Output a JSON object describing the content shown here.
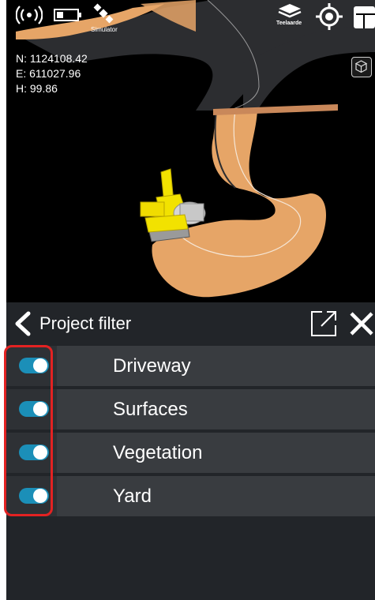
{
  "status": {
    "simulator_label": "Simulator",
    "project_label": "Teelaarde"
  },
  "coordinates": {
    "north": "N: 1124108.42",
    "east": "E: 611027.96",
    "height": "H: 99.86"
  },
  "panel": {
    "title": "Project filter",
    "items": [
      {
        "label": "Driveway",
        "enabled": true
      },
      {
        "label": "Surfaces",
        "enabled": true
      },
      {
        "label": "Vegetation",
        "enabled": true
      },
      {
        "label": "Yard",
        "enabled": true
      }
    ]
  },
  "colors": {
    "toggle_on": "#1b8fb8",
    "road_surface": "#e6a567",
    "asphalt": "#2c2d30",
    "highlight": "#e32222"
  },
  "icons": [
    "signal-icon",
    "battery-icon",
    "satellite-icon",
    "layers-icon",
    "gps-target-icon",
    "grid-icon",
    "view-cube-icon",
    "back-chevron-icon",
    "popout-icon",
    "close-icon"
  ]
}
